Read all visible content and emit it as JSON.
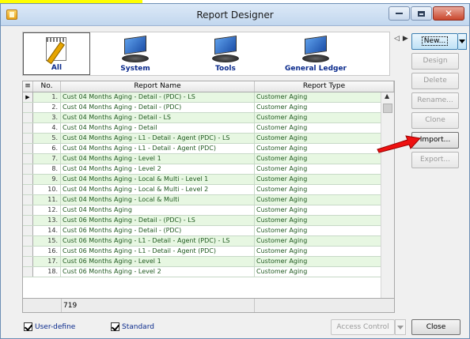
{
  "window": {
    "title": "Report Designer"
  },
  "categories": [
    {
      "label": "All",
      "icon": "notepad-icon",
      "selected": true
    },
    {
      "label": "System",
      "icon": "monitor-icon",
      "selected": false
    },
    {
      "label": "Tools",
      "icon": "monitor-icon",
      "selected": false
    },
    {
      "label": "General Ledger",
      "icon": "monitor-icon",
      "selected": false
    }
  ],
  "side_buttons": {
    "new": "New...",
    "design": "Design",
    "delete": "Delete",
    "rename": "Rename...",
    "clone": "Clone",
    "import": "Import...",
    "export": "Export..."
  },
  "grid": {
    "columns": {
      "no": "No.",
      "name": "Report Name",
      "type": "Report Type"
    },
    "rows": [
      {
        "no": "1.",
        "name": "Cust 04 Months Aging - Detail - (PDC) - LS",
        "type": "Customer Aging"
      },
      {
        "no": "2.",
        "name": "Cust 04 Months Aging - Detail - (PDC)",
        "type": "Customer Aging"
      },
      {
        "no": "3.",
        "name": "Cust 04 Months Aging - Detail - LS",
        "type": "Customer Aging"
      },
      {
        "no": "4.",
        "name": "Cust 04 Months Aging - Detail",
        "type": "Customer Aging"
      },
      {
        "no": "5.",
        "name": "Cust 04 Months Aging - L1 - Detail - Agent (PDC) - LS",
        "type": "Customer Aging"
      },
      {
        "no": "6.",
        "name": "Cust 04 Months Aging - L1 - Detail - Agent (PDC)",
        "type": "Customer Aging"
      },
      {
        "no": "7.",
        "name": "Cust 04 Months Aging - Level 1",
        "type": "Customer Aging"
      },
      {
        "no": "8.",
        "name": "Cust 04 Months Aging - Level 2",
        "type": "Customer Aging"
      },
      {
        "no": "9.",
        "name": "Cust 04 Months Aging - Local & Multi - Level 1",
        "type": "Customer Aging"
      },
      {
        "no": "10.",
        "name": "Cust 04 Months Aging - Local & Multi - Level 2",
        "type": "Customer Aging"
      },
      {
        "no": "11.",
        "name": "Cust 04 Months Aging - Local & Multi",
        "type": "Customer Aging"
      },
      {
        "no": "12.",
        "name": "Cust 04 Months Aging",
        "type": "Customer Aging"
      },
      {
        "no": "13.",
        "name": "Cust 06 Months Aging - Detail - (PDC) - LS",
        "type": "Customer Aging"
      },
      {
        "no": "14.",
        "name": "Cust 06 Months Aging - Detail - (PDC)",
        "type": "Customer Aging"
      },
      {
        "no": "15.",
        "name": "Cust 06 Months Aging - L1 - Detail - Agent (PDC) - LS",
        "type": "Customer Aging"
      },
      {
        "no": "16.",
        "name": "Cust 06 Months Aging - L1 - Detail - Agent (PDC)",
        "type": "Customer Aging"
      },
      {
        "no": "17.",
        "name": "Cust 06 Months Aging - Level 1",
        "type": "Customer Aging"
      },
      {
        "no": "18.",
        "name": "Cust 06 Months Aging - Level 2",
        "type": "Customer Aging"
      }
    ],
    "footer_count": "719"
  },
  "bottom": {
    "user_define": "User-define",
    "standard": "Standard",
    "access_control": "Access Control",
    "close": "Close"
  }
}
